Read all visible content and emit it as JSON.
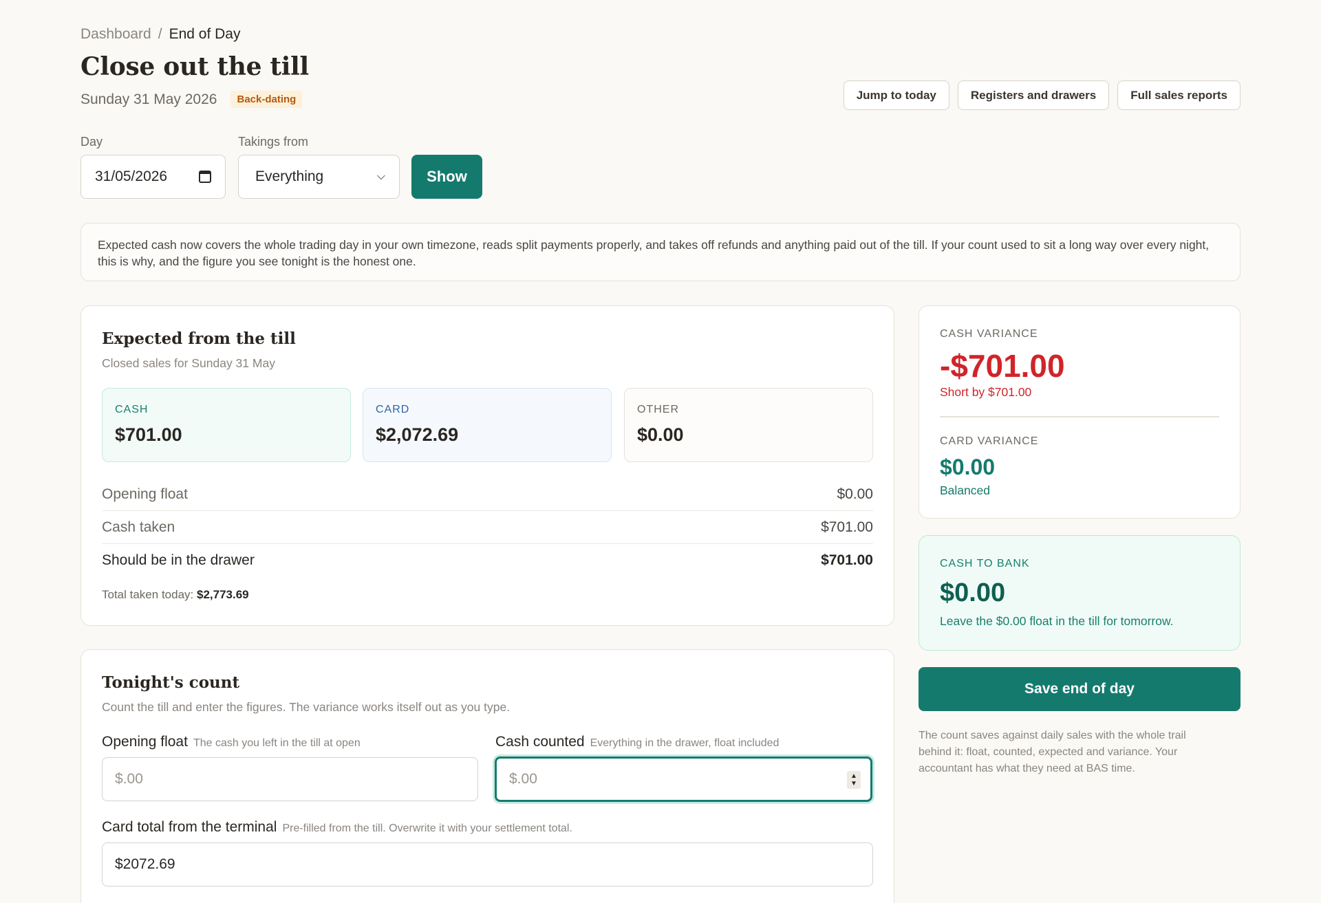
{
  "breadcrumb": {
    "root": "Dashboard",
    "separator": "/",
    "current": "End of Day"
  },
  "page": {
    "title": "Close out the till",
    "date": "Sunday 31 May 2026",
    "badge": "Back-dating"
  },
  "actions": {
    "jump_today": "Jump to today",
    "registers": "Registers and drawers",
    "reports": "Full sales reports"
  },
  "filters": {
    "day_label": "Day",
    "day_value": "31/05/2026",
    "takings_label": "Takings from",
    "takings_value": "Everything",
    "show_label": "Show"
  },
  "notice": "Expected cash now covers the whole trading day in your own timezone, reads split payments properly, and takes off refunds and anything paid out of the till. If your count used to sit a long way over every night, this is why, and the figure you see tonight is the honest one.",
  "expected": {
    "title": "Expected from the till",
    "subtitle": "Closed sales for Sunday 31 May",
    "tiles": [
      {
        "label": "CASH",
        "value": "$701.00"
      },
      {
        "label": "CARD",
        "value": "$2,072.69"
      },
      {
        "label": "OTHER",
        "value": "$0.00"
      }
    ],
    "rows": [
      {
        "label": "Opening float",
        "value": "$0.00"
      },
      {
        "label": "Cash taken",
        "value": "$701.00"
      },
      {
        "label": "Should be in the drawer",
        "value": "$701.00"
      }
    ],
    "total_label": "Total taken today:",
    "total_value": "$2,773.69"
  },
  "count": {
    "title": "Tonight's count",
    "subtitle": "Count the till and enter the figures. The variance works itself out as you type.",
    "opening_float": {
      "label": "Opening float",
      "hint": "The cash you left in the till at open",
      "placeholder": "$.00"
    },
    "cash_counted": {
      "label": "Cash counted",
      "hint": "Everything in the drawer, float included",
      "placeholder": "$.00"
    },
    "card_total": {
      "label": "Card total from the terminal",
      "hint": "Pre-filled from the till. Overwrite it with your settlement total.",
      "value": "$2072.69"
    }
  },
  "variance": {
    "cash_label": "CASH VARIANCE",
    "cash_value": "-$701.00",
    "cash_note": "Short by $701.00",
    "card_label": "CARD VARIANCE",
    "card_value": "$0.00",
    "card_note": "Balanced"
  },
  "bank": {
    "label": "CASH TO BANK",
    "value": "$0.00",
    "note": "Leave the $0.00 float in the till for tomorrow."
  },
  "save": {
    "label": "Save end of day",
    "note": "The count saves against daily sales with the whole trail behind it: float, counted, expected and variance. Your accountant has what they need at BAS time."
  },
  "colors": {
    "accent": "#157a6e",
    "danger": "#d1242a",
    "badge_text": "#b35a12",
    "card_blue": "#2f62a8"
  }
}
